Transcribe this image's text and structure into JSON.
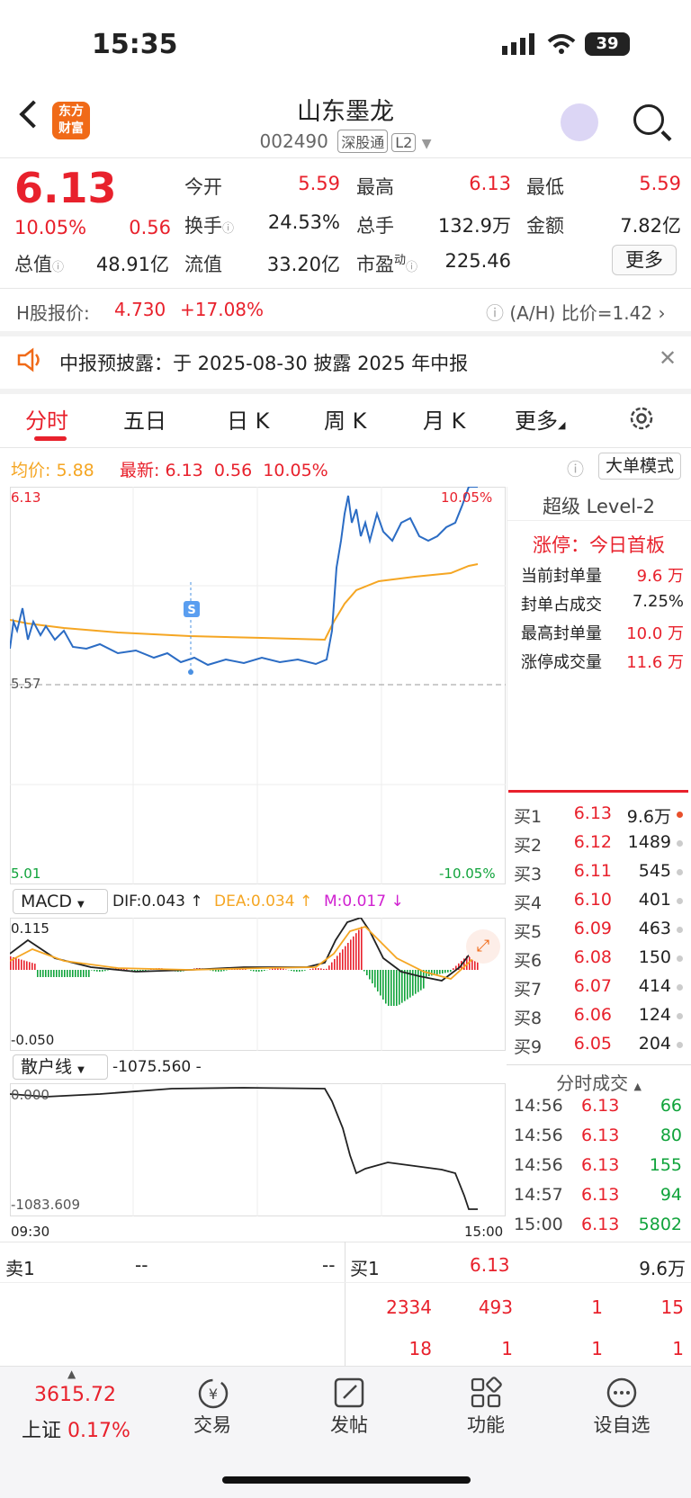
{
  "status_bar": {
    "time": "15:35",
    "battery": "39"
  },
  "header": {
    "title": "山东墨龙",
    "code": "002490",
    "tag1": "深股通",
    "tag2": "L2",
    "logo_line1": "东方",
    "logo_line2": "财富"
  },
  "quote": {
    "price": "6.13",
    "change_pct": "10.05%",
    "change": "0.56",
    "open_label": "今开",
    "open": "5.59",
    "high_label": "最高",
    "high": "6.13",
    "low_label": "最低",
    "low": "5.59",
    "turnover_label": "换手",
    "turnover": "24.53%",
    "volume_label": "总手",
    "volume": "132.9万",
    "amount_label": "金额",
    "amount": "7.82亿",
    "mktcap_label": "总值",
    "mktcap": "48.91亿",
    "float_label": "流值",
    "float": "33.20亿",
    "pe_label": "市盈",
    "pe_sup": "动",
    "pe": "225.46",
    "more_button": "更多"
  },
  "hshare": {
    "label": "H股报价:",
    "price": "4.730",
    "premium": "+17.08%",
    "ah_label": "(A/H) 比价=1.42"
  },
  "notice": {
    "text": "中报预披露：于 2025-08-30 披露 2025 年中报"
  },
  "tabs": [
    "分时",
    "五日",
    "日 K",
    "周 K",
    "月 K",
    "更多"
  ],
  "chart_info": {
    "avg_label": "均价:",
    "avg": "5.88",
    "latest_label": "最新:",
    "latest": "6.13",
    "latest_chg": "0.56",
    "latest_pct": "10.05%",
    "bigmode_button": "大单模式"
  },
  "chart_data": {
    "type": "line",
    "price_axis": {
      "top": "6.13",
      "mid": "5.57",
      "bottom": "5.01",
      "top_pct": "10.05%",
      "bottom_pct": "-10.05%"
    },
    "time_labels": [
      "09:30",
      "15:00"
    ],
    "marker": "S",
    "macd": {
      "selector": "MACD",
      "dif": "DIF:0.043 ↑",
      "dea": "DEA:0.034 ↑",
      "m": "M:0.017 ↓",
      "ymax": "0.115",
      "ymin": "-0.050"
    },
    "retail": {
      "selector": "散户线",
      "value": "-1075.560 -",
      "ymax": "0.000",
      "ymin": "-1083.609"
    }
  },
  "level2": {
    "title": "超级 Level-2",
    "limit_label": "涨停：今日首板",
    "rows": [
      {
        "label": "当前封单量",
        "value": "9.6 万"
      },
      {
        "label": "封单占成交",
        "value": "7.25%"
      },
      {
        "label": "最高封单量",
        "value": "10.0 万"
      },
      {
        "label": "涨停成交量",
        "value": "11.6 万"
      }
    ]
  },
  "orderbook": [
    {
      "label": "买1",
      "price": "6.13",
      "vol": "9.6万"
    },
    {
      "label": "买2",
      "price": "6.12",
      "vol": "1489"
    },
    {
      "label": "买3",
      "price": "6.11",
      "vol": "545"
    },
    {
      "label": "买4",
      "price": "6.10",
      "vol": "401"
    },
    {
      "label": "买5",
      "price": "6.09",
      "vol": "463"
    },
    {
      "label": "买6",
      "price": "6.08",
      "vol": "150"
    },
    {
      "label": "买7",
      "price": "6.07",
      "vol": "414"
    },
    {
      "label": "买8",
      "price": "6.06",
      "vol": "124"
    },
    {
      "label": "买9",
      "price": "6.05",
      "vol": "204"
    }
  ],
  "trades": {
    "title": "分时成交",
    "rows": [
      {
        "time": "14:56",
        "price": "6.13",
        "vol": "66"
      },
      {
        "time": "14:56",
        "price": "6.13",
        "vol": "80"
      },
      {
        "time": "14:56",
        "price": "6.13",
        "vol": "155"
      },
      {
        "time": "14:57",
        "price": "6.13",
        "vol": "94"
      },
      {
        "time": "15:00",
        "price": "6.13",
        "vol": "5802"
      }
    ]
  },
  "queue": {
    "sell_label": "卖1",
    "sell_price": "--",
    "sell_vol": "--",
    "buy_label": "买1",
    "buy_price": "6.13",
    "buy_vol": "9.6万",
    "row1": [
      "2334",
      "493",
      "1",
      "15"
    ],
    "row2": [
      "18",
      "1",
      "1",
      "1"
    ]
  },
  "bottom_nav": {
    "index_value": "3615.72",
    "index_name": "上证",
    "index_pct": "0.17%",
    "items": [
      "交易",
      "发帖",
      "功能",
      "设自选"
    ]
  }
}
